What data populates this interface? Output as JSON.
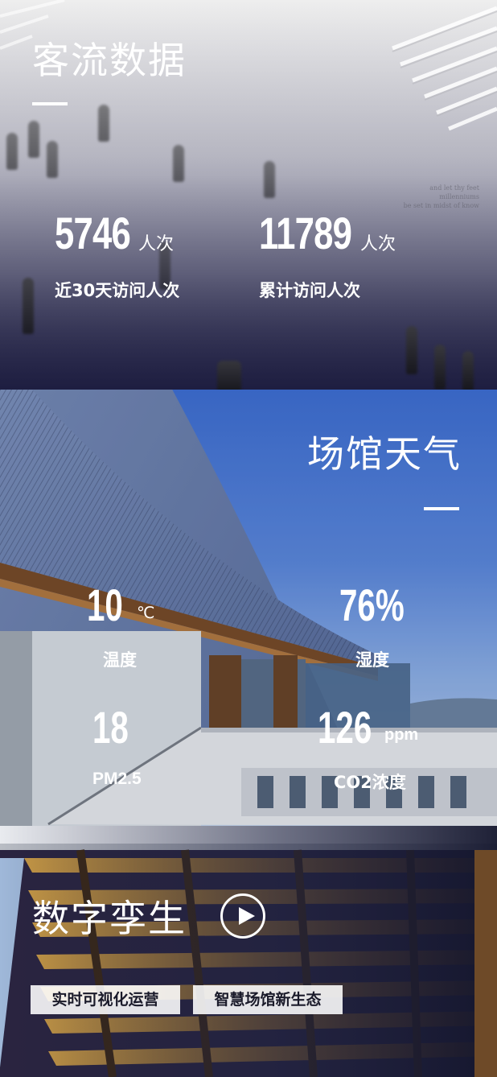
{
  "visitors": {
    "title": "客流数据",
    "stats": [
      {
        "value": "5746",
        "unit": "人次",
        "label": "近30天访问人次"
      },
      {
        "value": "11789",
        "unit": "人次",
        "label": "累计访问人次"
      }
    ],
    "wall_text": [
      "and let thy feet",
      "millenniums",
      "be set in midst of know"
    ]
  },
  "weather": {
    "title": "场馆天气",
    "items": [
      {
        "value": "10",
        "unit": "℃",
        "label": "温度"
      },
      {
        "value": "76%",
        "unit": "",
        "label": "湿度"
      },
      {
        "value": "18",
        "unit": "",
        "label": "PM2.5"
      },
      {
        "value": "126",
        "unit": "ppm",
        "label": "CO2浓度"
      }
    ]
  },
  "twin": {
    "title": "数字孪生",
    "tags": [
      "实时可视化运营",
      "智慧场馆新生态"
    ]
  },
  "colors": {
    "accent": "#ffffff",
    "sky": "#3e6fd6",
    "twin_bg": "#1e2240"
  }
}
